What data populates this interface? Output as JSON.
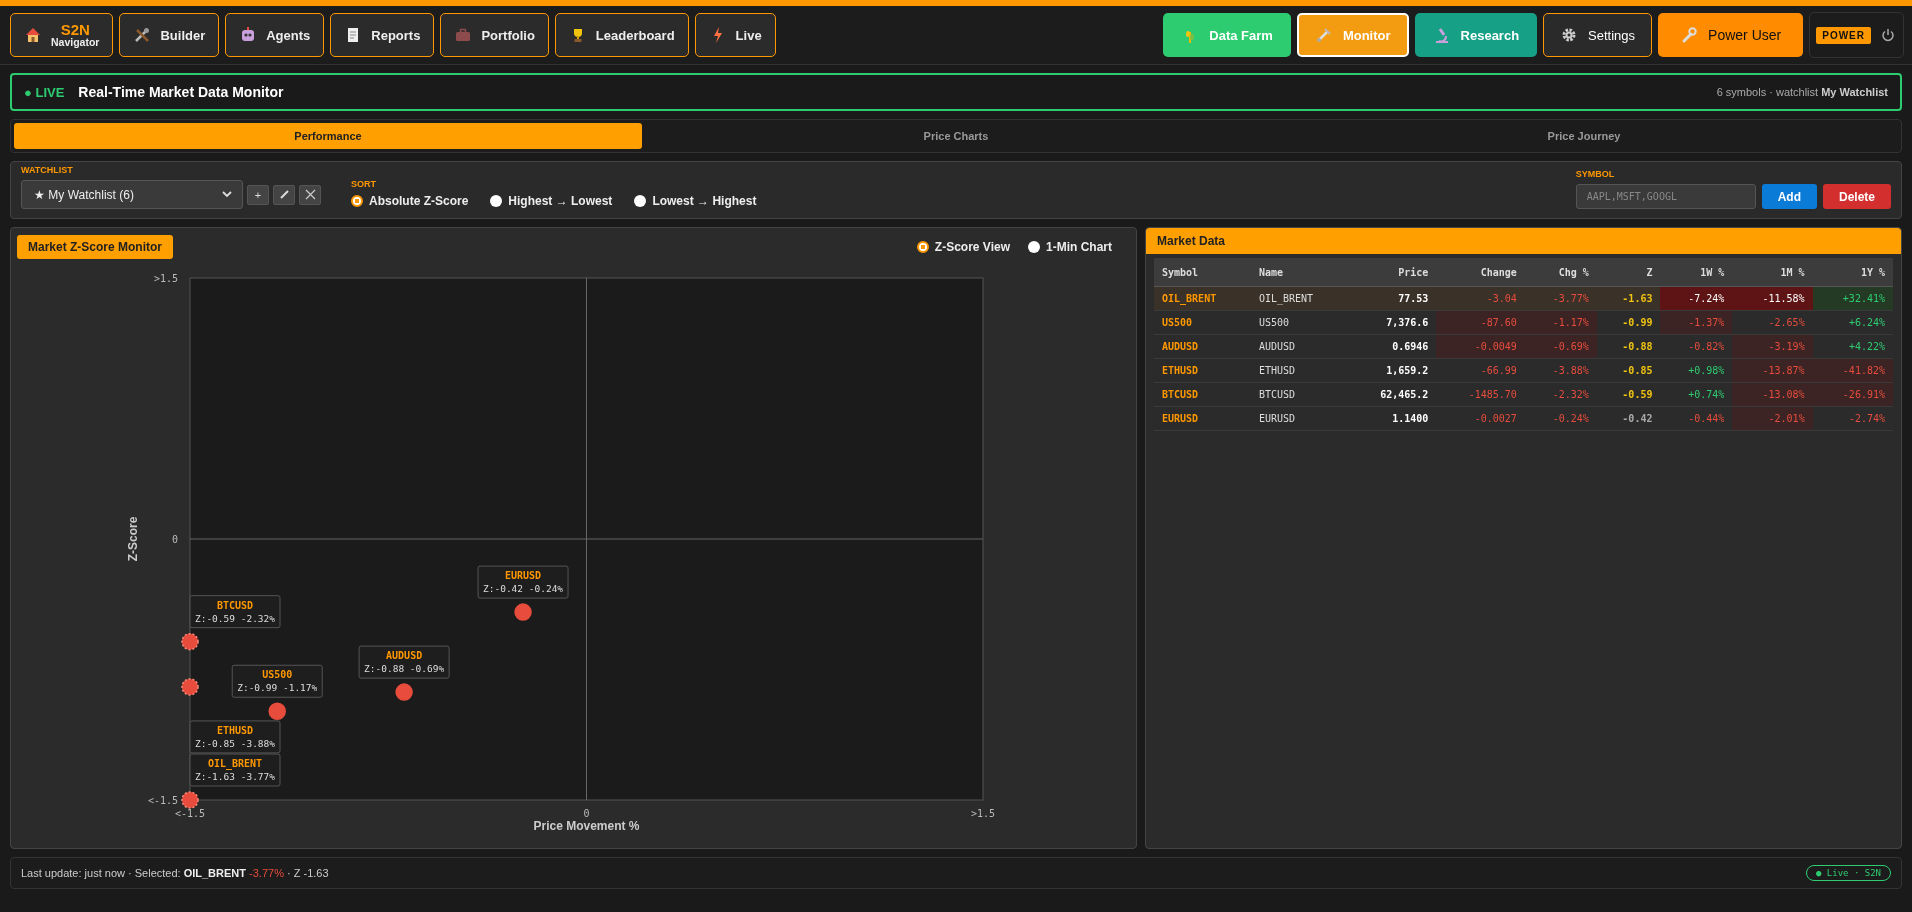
{
  "nav_left": [
    {
      "label": "S2N",
      "sub": "Navigator"
    },
    {
      "label": "Builder"
    },
    {
      "label": "Agents"
    },
    {
      "label": "Reports"
    },
    {
      "label": "Portfolio"
    },
    {
      "label": "Leaderboard"
    },
    {
      "label": "Live"
    }
  ],
  "nav_right": [
    {
      "label": "Data Farm",
      "color": "#2ecc71",
      "selected": false
    },
    {
      "label": "Monitor",
      "color": "#f39c12",
      "selected": true
    },
    {
      "label": "Research",
      "color": "#16a085",
      "selected": false
    },
    {
      "label": "Settings",
      "color": "#2a2a2a",
      "selected": false
    },
    {
      "label": "Power User",
      "color": "#ff8c00",
      "selected": false
    }
  ],
  "mode_badge": "POWER",
  "banner": {
    "live": "● LIVE",
    "title": "Real-Time Market Data Monitor",
    "summary": "6 symbols · watchlist **My Watchlist**"
  },
  "tabs": [
    {
      "label": "Performance",
      "selected": true
    },
    {
      "label": "Price Charts",
      "selected": false
    },
    {
      "label": "Price Journey",
      "selected": false
    }
  ],
  "controls": {
    "watchlist_label": "WATCHLIST",
    "watchlist_value": "★ My Watchlist (6)",
    "add_label": "+",
    "sort_label": "SORT",
    "sort_options": [
      {
        "label": "Absolute Z-Score",
        "selected": true
      },
      {
        "label": "Highest → Lowest",
        "selected": false
      },
      {
        "label": "Lowest → Highest",
        "selected": false
      }
    ],
    "symbol_label": "SYMBOL",
    "symbol_placeholder": "AAPL,MSFT,GOOGL",
    "add_button": "Add",
    "delete_button": "Delete"
  },
  "zscore_panel": {
    "title": "Market Z-Score Monitor",
    "views": [
      {
        "label": "Z-Score View",
        "selected": true
      },
      {
        "label": "1-Min Chart",
        "selected": false
      }
    ],
    "x_axis_title": "Price Movement %",
    "y_axis_title": "Z-Score",
    "y_axis_labels": [
      ">1.5",
      "0",
      "<-1.5"
    ],
    "x_axis_labels": [
      "<-1.5",
      "0",
      ">1.5"
    ],
    "point_labels": [
      {
        "symbol": "EURUSD",
        "text": "Z:-0.42 -0.24%",
        "clamped": false
      },
      {
        "symbol": "BTCUSD",
        "text": "Z:-0.59 -2.32%",
        "clamped": true
      },
      {
        "symbol": "AUDUSD",
        "text": "Z:-0.88 -0.69%",
        "clamped": false
      },
      {
        "symbol": "US500",
        "text": "Z:-0.99 -1.17%",
        "clamped": false
      },
      {
        "symbol": "ETHUSD",
        "text": "Z:-0.85 -3.88%",
        "clamped": true
      },
      {
        "symbol": "OIL_BRENT",
        "text": "Z:-1.63 -3.77%",
        "clamped": true
      }
    ]
  },
  "market_data": {
    "title": "Market Data",
    "columns": [
      "Symbol",
      "Name",
      "Price",
      "Change",
      "Chg %",
      "Z",
      "1W %",
      "1M %",
      "1Y %"
    ],
    "rows": [
      {
        "selected": true,
        "cells": [
          {
            "text": "OIL_BRENT",
            "color": "#ff9800",
            "kind": "plain"
          },
          {
            "text": "OIL_BRENT",
            "color": "#dddddd",
            "kind": "plain"
          },
          {
            "text": "77.53",
            "color": "#ffffff",
            "kind": "plain"
          },
          {
            "text": "-3.04",
            "color": "#e74c3c",
            "kind": "plain"
          },
          {
            "text": "-3.77%",
            "color": "#e74c3c",
            "kind": "plain"
          },
          {
            "text": "-1.63",
            "color": "#f1c40f",
            "kind": "plain"
          },
          {
            "text": "-7.24%",
            "color": "#ffffff",
            "kind": "deep"
          },
          {
            "text": "-11.58%",
            "color": "#ffffff",
            "kind": "deep"
          },
          {
            "text": "+32.41%",
            "color": "#2ecc71",
            "kind": "gain"
          }
        ]
      },
      {
        "selected": false,
        "cells": [
          {
            "text": "US500",
            "color": "#ff9800",
            "kind": "plain"
          },
          {
            "text": "US500",
            "color": "#dddddd",
            "kind": "plain"
          },
          {
            "text": "7,376.6",
            "color": "#ffffff",
            "kind": "plain"
          },
          {
            "text": "-87.60",
            "color": "#e74c3c",
            "kind": "tinted"
          },
          {
            "text": "-1.17%",
            "color": "#e74c3c",
            "kind": "tinted"
          },
          {
            "text": "-0.99",
            "color": "#f1c40f",
            "kind": "plain"
          },
          {
            "text": "-1.37%",
            "color": "#e74c3c",
            "kind": "tinted"
          },
          {
            "text": "-2.65%",
            "color": "#e74c3c",
            "kind": "plain"
          },
          {
            "text": "+6.24%",
            "color": "#2ecc71",
            "kind": "plain"
          }
        ]
      },
      {
        "selected": false,
        "cells": [
          {
            "text": "AUDUSD",
            "color": "#ff9800",
            "kind": "plain"
          },
          {
            "text": "AUDUSD",
            "color": "#dddddd",
            "kind": "plain"
          },
          {
            "text": "0.6946",
            "color": "#ffffff",
            "kind": "plain"
          },
          {
            "text": "-0.0049",
            "color": "#e74c3c",
            "kind": "tinted"
          },
          {
            "text": "-0.69%",
            "color": "#e74c3c",
            "kind": "tinted"
          },
          {
            "text": "-0.88",
            "color": "#f1c40f",
            "kind": "plain"
          },
          {
            "text": "-0.82%",
            "color": "#e74c3c",
            "kind": "plain"
          },
          {
            "text": "-3.19%",
            "color": "#e74c3c",
            "kind": "tinted"
          },
          {
            "text": "+4.22%",
            "color": "#2ecc71",
            "kind": "plain"
          }
        ]
      },
      {
        "selected": false,
        "cells": [
          {
            "text": "ETHUSD",
            "color": "#ff9800",
            "kind": "plain"
          },
          {
            "text": "ETHUSD",
            "color": "#dddddd",
            "kind": "plain"
          },
          {
            "text": "1,659.2",
            "color": "#ffffff",
            "kind": "plain"
          },
          {
            "text": "-66.99",
            "color": "#e74c3c",
            "kind": "plain"
          },
          {
            "text": "-3.88%",
            "color": "#e74c3c",
            "kind": "plain"
          },
          {
            "text": "-0.85",
            "color": "#f1c40f",
            "kind": "plain"
          },
          {
            "text": "+0.98%",
            "color": "#2ecc71",
            "kind": "plain"
          },
          {
            "text": "-13.87%",
            "color": "#e74c3c",
            "kind": "tinted"
          },
          {
            "text": "-41.82%",
            "color": "#e74c3c",
            "kind": "tinted"
          }
        ]
      },
      {
        "selected": false,
        "cells": [
          {
            "text": "BTCUSD",
            "color": "#ff9800",
            "kind": "plain"
          },
          {
            "text": "BTCUSD",
            "color": "#dddddd",
            "kind": "plain"
          },
          {
            "text": "62,465.2",
            "color": "#ffffff",
            "kind": "plain"
          },
          {
            "text": "-1485.70",
            "color": "#e74c3c",
            "kind": "plain"
          },
          {
            "text": "-2.32%",
            "color": "#e74c3c",
            "kind": "plain"
          },
          {
            "text": "-0.59",
            "color": "#f1c40f",
            "kind": "plain"
          },
          {
            "text": "+0.74%",
            "color": "#2ecc71",
            "kind": "plain"
          },
          {
            "text": "-13.08%",
            "color": "#e74c3c",
            "kind": "tinted"
          },
          {
            "text": "-26.91%",
            "color": "#e74c3c",
            "kind": "tinted"
          }
        ]
      },
      {
        "selected": false,
        "cells": [
          {
            "text": "EURUSD",
            "color": "#ff9800",
            "kind": "plain"
          },
          {
            "text": "EURUSD",
            "color": "#dddddd",
            "kind": "plain"
          },
          {
            "text": "1.1400",
            "color": "#ffffff",
            "kind": "plain"
          },
          {
            "text": "-0.0027",
            "color": "#e74c3c",
            "kind": "plain"
          },
          {
            "text": "-0.24%",
            "color": "#e74c3c",
            "kind": "plain"
          },
          {
            "text": "-0.42",
            "color": "#aaaaaa",
            "kind": "plain"
          },
          {
            "text": "-0.44%",
            "color": "#e74c3c",
            "kind": "plain"
          },
          {
            "text": "-2.01%",
            "color": "#e74c3c",
            "kind": "tinted"
          },
          {
            "text": "-2.74%",
            "color": "#e74c3c",
            "kind": "plain"
          }
        ]
      }
    ]
  },
  "status_bar": {
    "text": "Last update: just now · Selected: **OIL_BRENT**",
    "change": "-3.77%",
    "z": "· Z -1.63",
    "pill": "● Live · S2N"
  }
}
